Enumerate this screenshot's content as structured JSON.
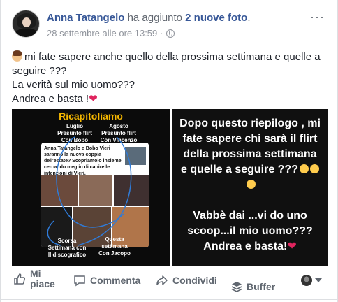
{
  "post": {
    "author": "Anna Tatangelo",
    "action_prefix": " ha aggiunto ",
    "action_link": "2 nuove foto",
    "action_suffix": ".",
    "timestamp": "28 settembre alle ore 13:59",
    "dot": "·",
    "privacy_icon": "globe-icon",
    "more": "···",
    "text_line1": "mi fate sapere anche quello della prossima settimana e quelle a seguire ???",
    "text_line2": "La verità sul mio uomo???",
    "text_line3": "Andrea e basta !",
    "heart": "❤"
  },
  "photo_left": {
    "title": "Ricapitoliamo",
    "label_luglio": "Luglio\nPresunto flirt\nCon Bobo",
    "label_agosto": "Agosto\nPresunto flirt\nCon Vincenzo",
    "box_text": "Anna Tatangelo e Bobo Vieri saranno la nuova coppia dell'estate? Scopriamolo insieme cercando meglio di capire le intenzioni di Vieri.",
    "label_scorsa": "Scorsa\nSettimana con\nIl discografico",
    "label_questa": "Questa\nsettimana\nCon Jacopo"
  },
  "photo_right": {
    "main_text": "Dopo questo riepilogo , mi fate sapere chi sarà il flirt della prossima settimana e quelle a seguire ???",
    "second_text": "Vabbè dai ...vi do uno scoop...il mio uomo??? Andrea e basta!",
    "heart": "❤"
  },
  "actions": {
    "like": "Mi piace",
    "comment": "Commenta",
    "share": "Condividi",
    "buffer": "Buffer"
  },
  "colors": {
    "link": "#385898",
    "muted": "#90949c",
    "title_yellow": "#f5b700",
    "heart": "#e0245e"
  }
}
